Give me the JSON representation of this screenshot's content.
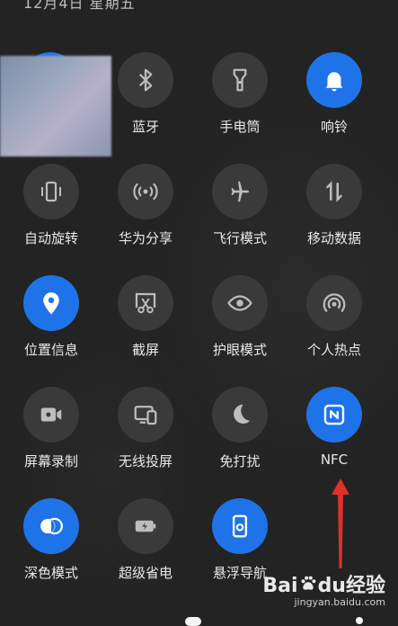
{
  "status": {
    "date_text": "12月4日 星期五"
  },
  "tiles": [
    {
      "label": "",
      "icon": "blurred-tile-icon",
      "active": true
    },
    {
      "label": "蓝牙",
      "icon": "bluetooth-icon",
      "active": false
    },
    {
      "label": "手电筒",
      "icon": "flashlight-icon",
      "active": false
    },
    {
      "label": "响铃",
      "icon": "bell-icon",
      "active": true
    },
    {
      "label": "自动旋转",
      "icon": "auto-rotate-icon",
      "active": false
    },
    {
      "label": "华为分享",
      "icon": "huawei-share-icon",
      "active": false
    },
    {
      "label": "飞行模式",
      "icon": "airplane-icon",
      "active": false
    },
    {
      "label": "移动数据",
      "icon": "mobile-data-icon",
      "active": false
    },
    {
      "label": "位置信息",
      "icon": "location-icon",
      "active": true
    },
    {
      "label": "截屏",
      "icon": "screenshot-icon",
      "active": false
    },
    {
      "label": "护眼模式",
      "icon": "eye-icon",
      "active": false
    },
    {
      "label": "个人热点",
      "icon": "hotspot-icon",
      "active": false
    },
    {
      "label": "屏幕录制",
      "icon": "screen-record-icon",
      "active": false
    },
    {
      "label": "无线投屏",
      "icon": "wireless-projection-icon",
      "active": false
    },
    {
      "label": "免打扰",
      "icon": "moon-icon",
      "active": false
    },
    {
      "label": "NFC",
      "icon": "nfc-icon",
      "active": true
    },
    {
      "label": "深色模式",
      "icon": "dark-mode-icon",
      "active": true
    },
    {
      "label": "超级省电",
      "icon": "battery-saver-icon",
      "active": false
    },
    {
      "label": "悬浮导航",
      "icon": "floating-nav-icon",
      "active": true
    }
  ],
  "watermark": {
    "brand": "Bai",
    "brand2": "du",
    "brand_cn": "经验",
    "site": "jingyan.baidu.com"
  },
  "colors": {
    "active": "#1f73e8",
    "inactive": "#3a3a3a",
    "background": "#232323",
    "arrow": "#e0302b"
  }
}
